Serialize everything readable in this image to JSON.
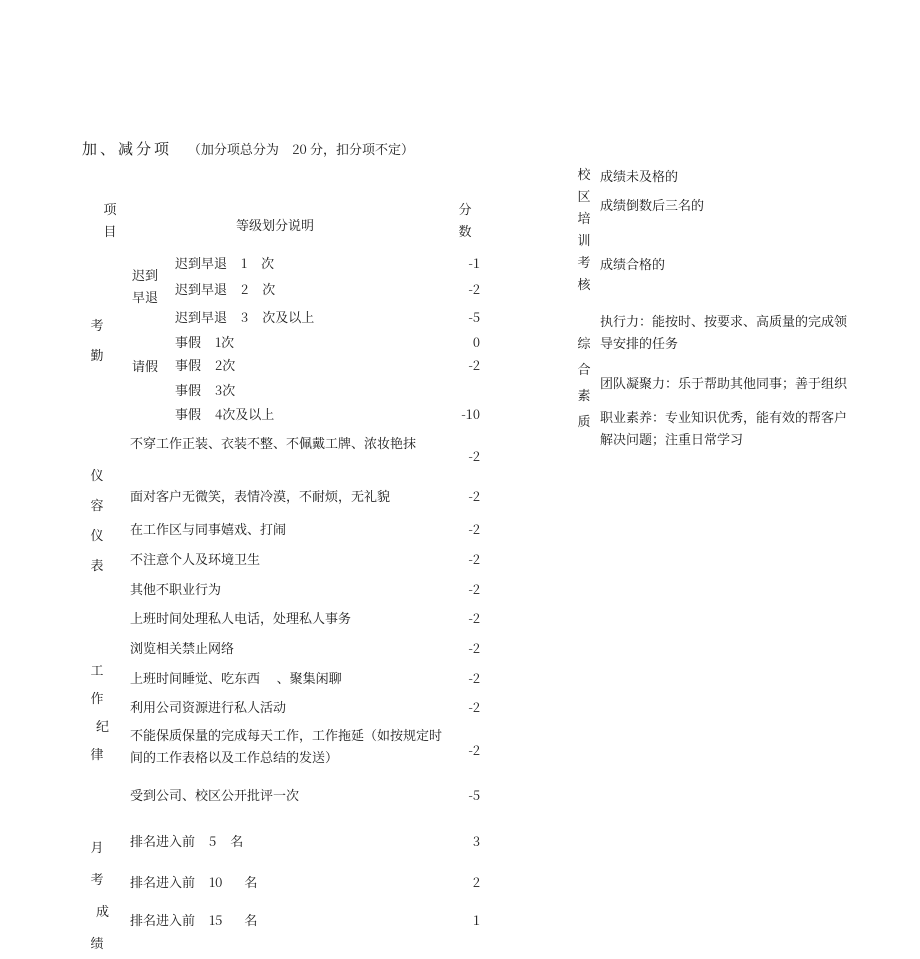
{
  "title": {
    "main": "加、减分项",
    "sub_prefix": "（加分项总分为",
    "sub_points": "20",
    "sub_unit": "分，扣分项不定）"
  },
  "headers": {
    "project": "项\n目",
    "desc": "等级划分说明",
    "score": "分\n数"
  },
  "left": {
    "kq": "考\n勤",
    "kq_sub_late": "迟到\n早退",
    "kq_sub_leave": "请假",
    "rows_kq": [
      {
        "d_a": "迟到早退",
        "d_b": "1",
        "d_c": "次",
        "s": "-1"
      },
      {
        "d_a": "迟到早退",
        "d_b": "2",
        "d_c": "次",
        "s": "-2"
      },
      {
        "d_a": "迟到早退",
        "d_b": "3",
        "d_c": "次及以上",
        "s": "-5"
      },
      {
        "d_a": "事假",
        "d_b": "1",
        "d_c": "次",
        "s": "0"
      },
      {
        "d_a": "事假",
        "d_b": "2",
        "d_c": "次",
        "s": "-2"
      },
      {
        "d_a": "事假",
        "d_b": "3",
        "d_c": "次",
        "s": ""
      },
      {
        "d_a": "事假",
        "d_b": "4",
        "d_c": "次及以上",
        "s": "-10"
      }
    ],
    "yr": "仪\n容\n仪\n表",
    "rows_yr": [
      {
        "d": "不穿工作正装、衣装不整、不佩戴工牌、浓妆艳抹",
        "s": "-2"
      },
      {
        "d": "面对客户无微笑，表情冷漠，不耐烦，无礼貌",
        "s": "-2"
      },
      {
        "d": "在工作区与同事嬉戏、打闹",
        "s": "-2"
      },
      {
        "d": "不注意个人及环境卫生",
        "s": "-2"
      },
      {
        "d": "其他不职业行为",
        "s": "-2"
      }
    ],
    "gz": "工\n作\n纪\n律",
    "rows_gz": [
      {
        "d": "上班时间处理私人电话，处理私人事务",
        "s": "-2"
      },
      {
        "d": "浏览相关禁止网络",
        "s": "-2"
      },
      {
        "d": "上班时间睡觉、吃东西     、聚集闲聊",
        "s": "-2"
      },
      {
        "d": "利用公司资源进行私人活动",
        "s": "-2"
      },
      {
        "d": "不能保质保量的完成每天工作，工作拖延（如按规定时间的工作表格以及工作总结的发送）",
        "s": "-2"
      },
      {
        "d": "受到公司、校区公开批评一次",
        "s": "-5"
      }
    ],
    "yk": "月\n考\n成\n绩",
    "rows_yk": [
      {
        "d_a": "排名进入前",
        "d_b": "5",
        "d_c": "名",
        "s": "3"
      },
      {
        "d_a": "排名进入前",
        "d_b": "10",
        "d_c": "名",
        "s": "2"
      },
      {
        "d_a": "排名进入前",
        "d_b": "15",
        "d_c": "名",
        "s": "1"
      }
    ]
  },
  "right": {
    "xq": "校\n区\n培\n训\n考\n核",
    "xq_items": [
      "成绩未及格的",
      "成绩倒数后三名的",
      "成绩合格的"
    ],
    "zh": "综\n合\n素\n质",
    "zh_items": [
      "执行力：能按时、按要求、高质量的完成领导安排的任务",
      "团队凝聚力：乐于帮助其他同事；善于组织",
      "职业素养：专业知识优秀，能有效的帮客户解决问题；注重日常学习"
    ]
  }
}
